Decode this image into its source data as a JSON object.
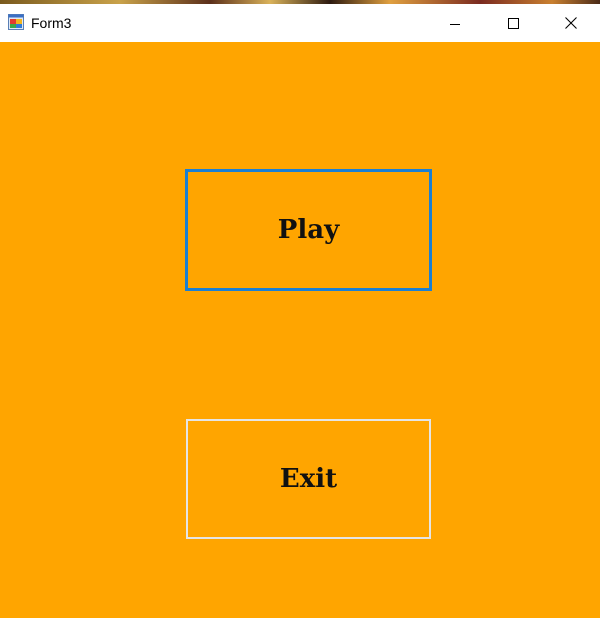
{
  "window": {
    "title": "Form3"
  },
  "titlebar": {
    "app_icon": "winforms-app-icon",
    "minimize_icon": "minimize-icon",
    "maximize_icon": "maximize-icon",
    "close_icon": "close-icon"
  },
  "client": {
    "background_color": "#ffa500"
  },
  "buttons": {
    "play": {
      "label": "Play",
      "focus_border_color": "#1a7fd4"
    },
    "exit": {
      "label": "Exit",
      "border_color": "#e5e5e5"
    }
  }
}
